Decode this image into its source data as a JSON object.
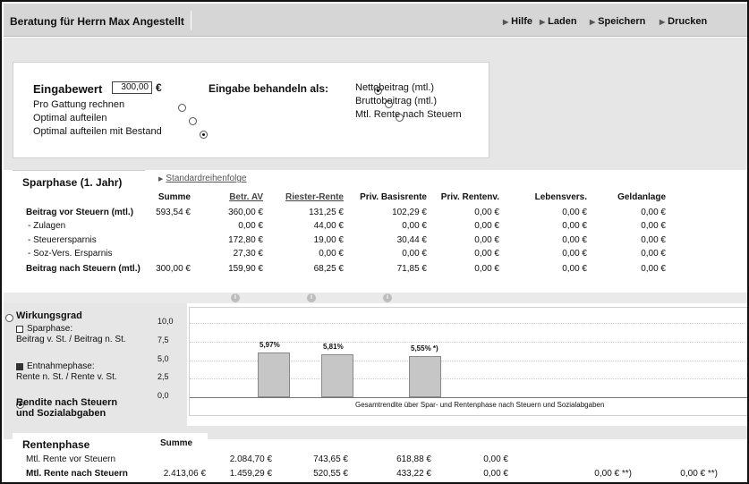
{
  "header": {
    "title": "Beratung für Herrn Max Angestellt",
    "buttons": [
      "Hilfe",
      "Laden",
      "Speichern",
      "Drucken"
    ]
  },
  "input": {
    "eingabewert_label": "Eingabewert",
    "eingabewert_value": "300,00",
    "currency": "€",
    "options_left": [
      "Pro Gattung rechnen",
      "Optimal aufteilen",
      "Optimal aufteilen mit Bestand"
    ],
    "options_left_selected": 2,
    "behandeln_label": "Eingabe behandeln als:",
    "options_right": [
      "Nettobeitrag (mtl.)",
      "Bruttobeitrag (mtl.)",
      "Mtl. Rente nach Steuern"
    ],
    "options_right_selected": 0
  },
  "sparphase": {
    "tab_label": "Sparphase (1. Jahr)",
    "link": "Standardreihenfolge",
    "headers": [
      "Summe",
      "Betr. AV",
      "Riester-Rente",
      "Priv. Basisrente",
      "Priv. Rentenv.",
      "Lebensvers.",
      "Geldanlage"
    ],
    "rows": [
      {
        "label": "Beitrag vor Steuern (mtl.)",
        "bold": true,
        "values": [
          "593,54 €",
          "360,00 €",
          "131,25 €",
          "102,29 €",
          "0,00 €",
          "0,00 €",
          "0,00 €"
        ]
      },
      {
        "label": "- Zulagen",
        "bold": false,
        "values": [
          "",
          "0,00 €",
          "44,00 €",
          "0,00 €",
          "0,00 €",
          "0,00 €",
          "0,00 €"
        ]
      },
      {
        "label": "- Steuerersparnis",
        "bold": false,
        "values": [
          "",
          "172,80 €",
          "19,00 €",
          "30,44 €",
          "0,00 €",
          "0,00 €",
          "0,00 €"
        ]
      },
      {
        "label": "- Soz-Vers. Ersparnis",
        "bold": false,
        "values": [
          "",
          "27,30 €",
          "0,00 €",
          "0,00 €",
          "0,00 €",
          "0,00 €",
          "0,00 €"
        ]
      },
      {
        "label": "Beitrag nach Steuern (mtl.)",
        "bold": true,
        "values": [
          "300,00 €",
          "159,90 €",
          "68,25 €",
          "71,85 €",
          "0,00 €",
          "0,00 €",
          "0,00 €"
        ]
      }
    ]
  },
  "left_options": {
    "wirkungsgrad": "Wirkungsgrad",
    "sparphase_label": "Sparphase:",
    "sparphase_desc": "Beitrag v. St. / Beitrag n. St.",
    "entnahme_label": "Entnahmephase:",
    "entnahme_desc": "Rente n. St. / Rente v. St.",
    "rendite_line1": "Rendite nach Steuern",
    "rendite_line2": "und Sozialabgaben"
  },
  "chart_data": {
    "type": "bar",
    "categories": [
      "Betr. AV",
      "Riester-Rente",
      "Priv. Basisrente"
    ],
    "values": [
      5.97,
      5.81,
      5.55
    ],
    "value_labels": [
      "5,97%",
      "5,81%",
      "5,55% *)"
    ],
    "ylim": [
      0,
      10
    ],
    "yticks": [
      "0,0",
      "2,5",
      "5,0",
      "7,5",
      "10,0"
    ],
    "xlabel": "Gesamtrendite über Spar- und Rentenphase nach Steuern und Sozialabgaben",
    "grid": true
  },
  "rentenphase": {
    "tab_label": "Rentenphase",
    "summe_label": "Summe",
    "rows": [
      {
        "label": "Mtl. Rente vor Steuern",
        "bold": false,
        "values": [
          "",
          "2.084,70 €",
          "743,65 €",
          "618,88 €",
          "0,00 €",
          "",
          ""
        ]
      },
      {
        "label": "Mtl. Rente nach Steuern",
        "bold": true,
        "values": [
          "2.413,06 €",
          "1.459,29 €",
          "520,55 €",
          "433,22 €",
          "0,00 €",
          "0,00 € **)",
          "0,00 € **)"
        ]
      }
    ]
  }
}
